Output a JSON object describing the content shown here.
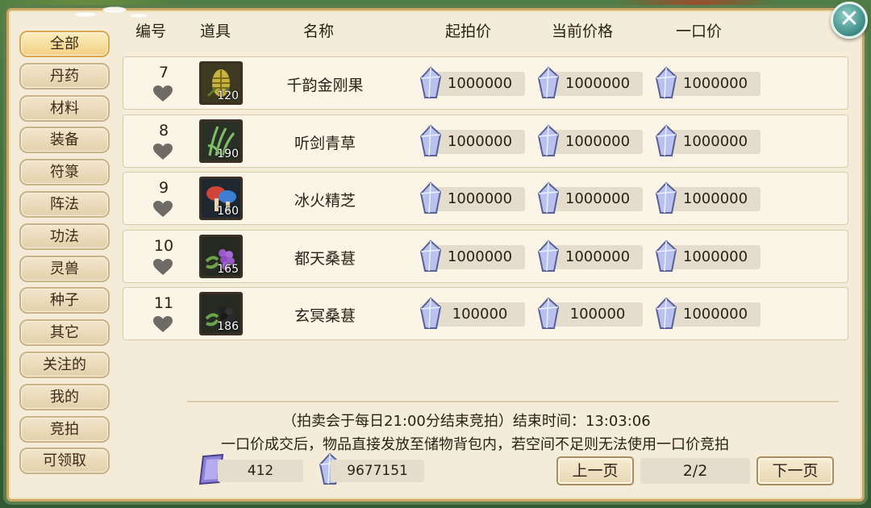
{
  "sidebar": {
    "items": [
      "全部",
      "丹药",
      "材料",
      "装备",
      "符箓",
      "阵法",
      "功法",
      "灵兽",
      "种子",
      "其它",
      "关注的",
      "我的",
      "竞拍",
      "可领取"
    ],
    "active_index": 0
  },
  "header": {
    "col_no": "编号",
    "col_item": "道具",
    "col_name": "名称",
    "col_start": "起拍价",
    "col_current": "当前价格",
    "col_buyout": "一口价"
  },
  "rows": [
    {
      "no": "7",
      "count": "120",
      "name": "千韵金刚果",
      "start": "1000000",
      "current": "1000000",
      "buyout": "1000000",
      "icon": "golden-pinecone-icon"
    },
    {
      "no": "8",
      "count": "190",
      "name": "听剑青草",
      "start": "1000000",
      "current": "1000000",
      "buyout": "1000000",
      "icon": "green-grass-icon"
    },
    {
      "no": "9",
      "count": "160",
      "name": "冰火精芝",
      "start": "1000000",
      "current": "1000000",
      "buyout": "1000000",
      "icon": "mushroom-icon"
    },
    {
      "no": "10",
      "count": "165",
      "name": "都天桑葚",
      "start": "1000000",
      "current": "1000000",
      "buyout": "1000000",
      "icon": "purple-berry-icon"
    },
    {
      "no": "11",
      "count": "186",
      "name": "玄冥桑葚",
      "start": "100000",
      "current": "100000",
      "buyout": "1000000",
      "icon": "black-berry-icon"
    }
  ],
  "footer": {
    "notice1": "（拍卖会于每日21:00分结束竞拍）结束时间：13:03:06",
    "notice2": "一口价成交后，物品直接发放至储物背包内，若空间不足则无法使用一口价竞拍",
    "currency1": "412",
    "currency2": "9677151",
    "prev_label": "上一页",
    "page": "2/2",
    "next_label": "下一页"
  },
  "close_label": "✕",
  "colors": {
    "panel_bg": "#f4ecd8",
    "gem": "#b9c2ee",
    "active_tab": "#f2cf80"
  }
}
